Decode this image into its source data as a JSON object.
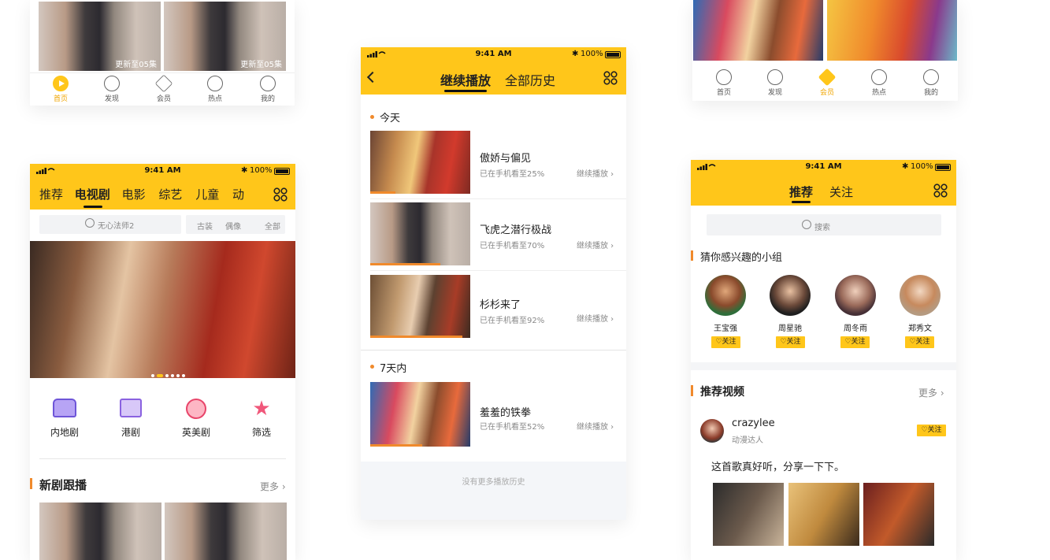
{
  "status": {
    "time": "9:41 AM",
    "battery": "100%"
  },
  "card_top_left": {
    "episode_badges": [
      "更新至05集",
      "更新至05集"
    ],
    "tabbar": [
      {
        "label": "首页",
        "icon": "home-play-icon",
        "active": true
      },
      {
        "label": "发现",
        "icon": "compass-icon"
      },
      {
        "label": "会员",
        "icon": "diamond-icon"
      },
      {
        "label": "热点",
        "icon": "hot-icon"
      },
      {
        "label": "我的",
        "icon": "user-icon"
      }
    ]
  },
  "card_left": {
    "nav_tabs": [
      "推荐",
      "电视剧",
      "电影",
      "综艺",
      "儿童",
      "动"
    ],
    "active_tab": "电视剧",
    "search_placeholder": "无心法师2",
    "filters": [
      "古装",
      "偶像",
      "全部"
    ],
    "categories": [
      {
        "label": "内地剧",
        "icon": "sofa-icon",
        "color": "#8b6de8"
      },
      {
        "label": "港剧",
        "icon": "tv-icon",
        "color": "#a77be8"
      },
      {
        "label": "英美剧",
        "icon": "film-reel-icon",
        "color": "#f0577a"
      },
      {
        "label": "筛选",
        "icon": "star-filter-icon",
        "color": "#f0577a"
      }
    ],
    "section_title": "新剧跟播",
    "more": "更多"
  },
  "card_middle": {
    "tabs": [
      "继续播放",
      "全部历史"
    ],
    "groups": [
      {
        "title": "今天",
        "items": [
          {
            "title": "傲娇与偏见",
            "progress": "已在手机看至25%",
            "action": "继续播放",
            "progress_value": 0.25
          },
          {
            "title": "飞虎之潜行极战",
            "progress": "已在手机看至70%",
            "action": "继续播放",
            "progress_value": 0.7
          },
          {
            "title": "杉杉来了",
            "progress": "已在手机看至92%",
            "action": "继续播放",
            "progress_value": 0.92
          }
        ]
      },
      {
        "title": "7天内",
        "items": [
          {
            "title": "羞羞的铁拳",
            "progress": "已在手机看至52%",
            "action": "继续播放",
            "progress_value": 0.52
          }
        ]
      }
    ],
    "footer": "没有更多播放历史"
  },
  "card_top_right": {
    "tabbar": [
      {
        "label": "首页",
        "icon": "play-circle-icon"
      },
      {
        "label": "发现",
        "icon": "compass-icon"
      },
      {
        "label": "会员",
        "icon": "diamond-icon",
        "active": true
      },
      {
        "label": "热点",
        "icon": "hot-icon"
      },
      {
        "label": "我的",
        "icon": "user-icon"
      }
    ]
  },
  "card_right": {
    "tabs": [
      "推荐",
      "关注"
    ],
    "search_placeholder": "搜索",
    "groups_title": "猜你感兴趣的小组",
    "people": [
      {
        "name": "王宝强",
        "follow": "关注"
      },
      {
        "name": "周星驰",
        "follow": "关注"
      },
      {
        "name": "周冬雨",
        "follow": "关注"
      },
      {
        "name": "郑秀文",
        "follow": "关注"
      }
    ],
    "videos_title": "推荐视频",
    "more": "更多",
    "post": {
      "user": "crazylee",
      "role": "动漫达人",
      "follow": "关注",
      "text": "这首歌真好听，分享一下下。"
    }
  },
  "colors": {
    "brand": "#ffc61a",
    "accent": "#f08a2c"
  }
}
